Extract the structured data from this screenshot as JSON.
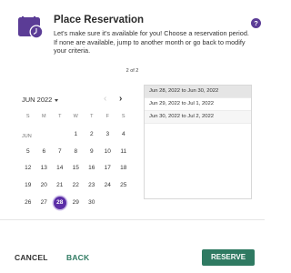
{
  "header": {
    "title": "Place Reservation",
    "description": "Let's make sure it's available for you! Choose a reservation period. If none are available, jump to another month or go back to modify your criteria.",
    "help_icon": "?"
  },
  "step": "2 of 2",
  "calendar": {
    "month_label": "JUN 2022",
    "month_short": "JUN",
    "weekdays": [
      "S",
      "M",
      "T",
      "W",
      "T",
      "F",
      "S"
    ],
    "selected_day": "28",
    "days": [
      "1",
      "2",
      "3",
      "4",
      "5",
      "6",
      "7",
      "8",
      "9",
      "10",
      "11",
      "12",
      "13",
      "14",
      "15",
      "16",
      "17",
      "18",
      "19",
      "20",
      "21",
      "22",
      "23",
      "24",
      "25",
      "26",
      "27",
      "28",
      "29",
      "30"
    ]
  },
  "results": [
    "Jun 28, 2022 to Jun 30, 2022",
    "Jun 29, 2022 to Jul 1, 2022",
    "Jun 30, 2022 to Jul 2, 2022"
  ],
  "footer": {
    "cancel_label": "CANCEL",
    "back_label": "BACK",
    "reserve_label": "RESERVE"
  },
  "colors": {
    "accent_purple": "#5b2ea6",
    "accent_green": "#2f7a62"
  }
}
